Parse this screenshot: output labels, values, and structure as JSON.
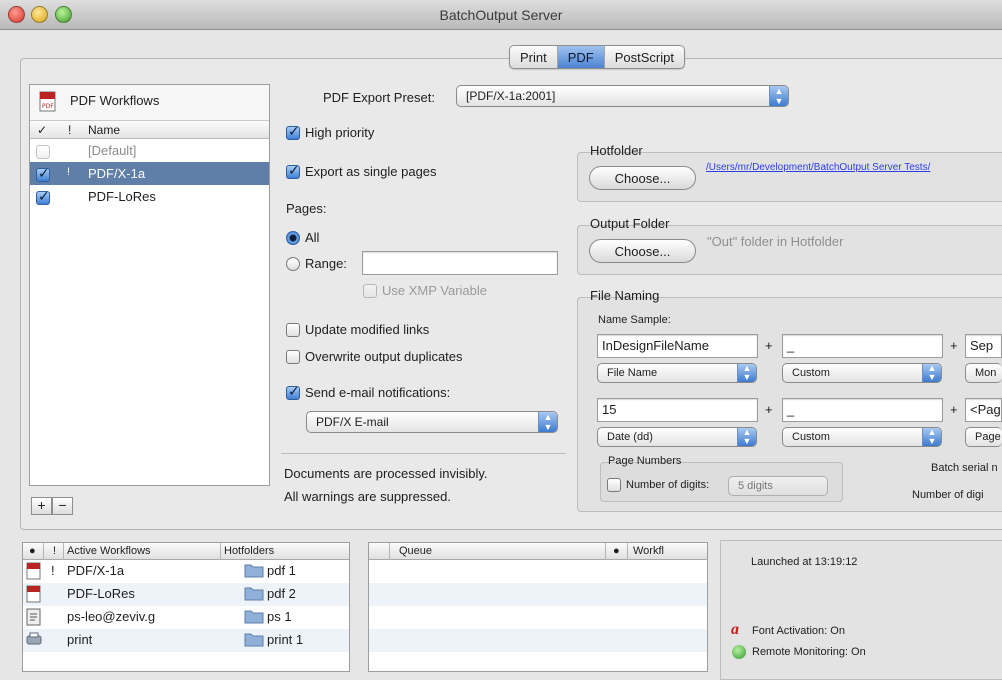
{
  "window": {
    "title": "BatchOutput Server"
  },
  "tabs": [
    {
      "label": "Print",
      "active": false
    },
    {
      "label": "PDF",
      "active": true
    },
    {
      "label": "PostScript",
      "active": false
    }
  ],
  "workflows": {
    "header": "PDF Workflows",
    "col_check": "✓",
    "col_lock": "!",
    "col_name": "Name",
    "items": [
      {
        "label": "[Default]",
        "checked": false,
        "selected": false
      },
      {
        "label": "PDF/X-1a",
        "checked": true,
        "selected": true
      },
      {
        "label": "PDF-LoRes",
        "checked": true,
        "selected": false
      }
    ],
    "add_label": "+",
    "remove_label": "−"
  },
  "settings": {
    "preset_label": "PDF Export Preset:",
    "preset_value": "[PDF/X-1a:2001]",
    "high_priority": "High priority",
    "single_pages": "Export as single pages",
    "pages_label": "Pages:",
    "all_label": "All",
    "range_label": "Range:",
    "xmp_label": "Use XMP Variable",
    "update_links": "Update modified links",
    "overwrite": "Overwrite output duplicates",
    "email_label": "Send e-mail notifications:",
    "email_value": "PDF/X E-mail",
    "note1": "Documents are processed invisibly.",
    "note2": "All warnings are suppressed."
  },
  "hotfolder": {
    "title": "Hotfolder",
    "choose": "Choose...",
    "path": "/Users/mr/Development/BatchOutput Server Tests/"
  },
  "output": {
    "title": "Output Folder",
    "choose": "Choose...",
    "hint": "\"Out\" folder in Hotfolder"
  },
  "naming": {
    "title": "File Naming",
    "sample_label": "Name Sample:",
    "field1": "InDesignFileName",
    "field2": "_",
    "field3": "Sep",
    "popup1": "File Name",
    "popup2": "Custom",
    "popup3": "Mon",
    "field4": "15",
    "field5": "_",
    "field6": "<Pag",
    "popup4": "Date (dd)",
    "popup5": "Custom",
    "popup6": "Page",
    "plus": "+",
    "page_numbers": "Page Numbers",
    "num_digits": "Number of digits:",
    "digits_value": "5 digits",
    "batch_serial": "Batch serial n",
    "number_digits2": "Number of digi"
  },
  "active_table": {
    "col_status": "●",
    "col_lock": "!",
    "col_active": "Active Workflows",
    "col_hot": "Hotfolders",
    "rows": [
      {
        "name": "PDF/X-1a",
        "folder": "pdf 1"
      },
      {
        "name": "PDF-LoRes",
        "folder": "pdf 2"
      },
      {
        "name": "ps-leo@zeviv.g",
        "folder": "ps 1"
      },
      {
        "name": "print",
        "folder": "print 1"
      }
    ]
  },
  "queue_table": {
    "col_queue": "Queue",
    "col_status": "●",
    "col_workf": "Workfl"
  },
  "status": {
    "launched": "Launched at 13:19:12",
    "font_activation": "Font Activation: On",
    "remote_monitoring": "Remote Monitoring: On"
  }
}
